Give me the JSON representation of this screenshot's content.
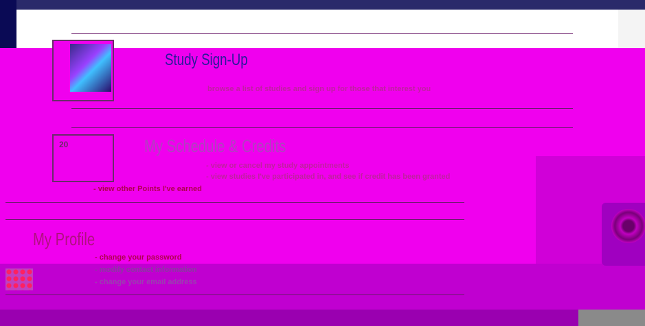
{
  "sections": [
    {
      "title": "Study Sign-Up",
      "items": [
        "browse a list of studies and sign up for those that interest you"
      ]
    },
    {
      "title": "My Schedule & Credits",
      "items": [
        "- view or cancel my study appointments",
        "- view studies I've participated in, and see if credit has been granted",
        "- view other Points I've earned"
      ],
      "calendar_number": "20"
    },
    {
      "title": "My Profile",
      "items": [
        "- change your password",
        "- modify contact information",
        "- change your email address"
      ]
    }
  ],
  "colors": {
    "background": "#e400f0",
    "title": "#2a1a9a",
    "desc": "#c020a0"
  }
}
